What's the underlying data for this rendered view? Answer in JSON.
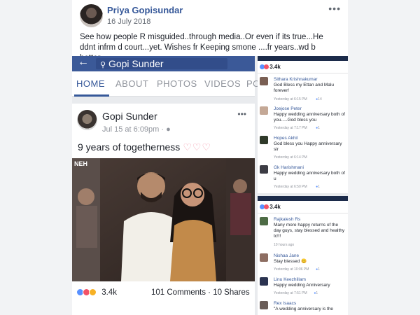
{
  "post": {
    "author": "Priya Gopisundar",
    "date": "16 July 2018",
    "options": "•••",
    "text": "See how people R misguided..through media..Or even if its true...He ddnt infrm d court...yet. Wishes fr Keeping smone ....fr years..wd b better.."
  },
  "embedded_left": {
    "search_text": "Gopi Sunder",
    "tabs": [
      "HOME",
      "ABOUT",
      "PHOTOS",
      "VIDEOS",
      "PO"
    ],
    "active_tab": "HOME",
    "card": {
      "author": "Gopi Sunder",
      "date": "Jul 15 at 6:09pm ·",
      "text": "9 years of togetherness",
      "hearts": "♡♡♡",
      "photo_tag": "NEH",
      "reaction_count": "3.4k",
      "comments_shares": "101 Comments · 10 Shares"
    }
  },
  "embedded_right": {
    "panel1": {
      "like_count": "3.4k",
      "comments": [
        {
          "name": "Sithara Krishnakumar",
          "text": "God Bless my Ettan and Malu forever!",
          "meta": "Yesterday at 6:15 PM",
          "likes": "14"
        },
        {
          "name": "Joejose Peter",
          "text": "Happy wedding anniversary both of you.....God bless you",
          "meta": "Yesterday at 7:17 PM",
          "likes": "1"
        },
        {
          "name": "Hopes Akhil",
          "text": "God bless you Happy anniversary sir",
          "meta": "Yesterday at 6:14 PM",
          "likes": ""
        },
        {
          "name": "Gk Harishmani",
          "text": "Happy wedding anniversary both of u",
          "meta": "Yesterday at 6:50 PM",
          "likes": "1"
        }
      ]
    },
    "panel2": {
      "like_count": "3.4k",
      "comments": [
        {
          "name": "Rajkalesh Rs",
          "text": "Many more happy returns of the day guys, stay blessed and healthy tc!!!",
          "meta": "10 hours ago",
          "likes": ""
        },
        {
          "name": "Nishaa Jane",
          "text": "Stay blessed 😊",
          "meta": "Yesterday at 10:06 PM",
          "likes": "1"
        },
        {
          "name": "Linu Keezhillam",
          "text": "Happy wedding Anniversary",
          "meta": "Yesterday at 7:51 PM",
          "likes": "1"
        },
        {
          "name": "Rex Isaacs",
          "text": "\"A wedding anniversary is the",
          "meta": "",
          "likes": ""
        }
      ]
    }
  },
  "colors": {
    "brand": "#3b5998",
    "link": "#365899",
    "like": "#5890ff",
    "love": "#f25268"
  }
}
